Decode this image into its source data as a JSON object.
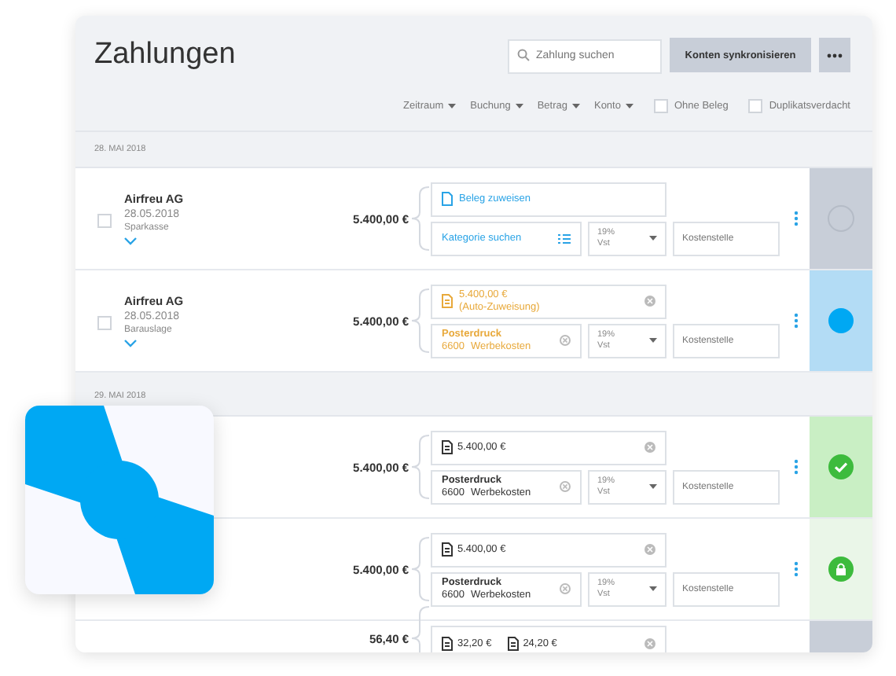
{
  "title": "Zahlungen",
  "search": {
    "placeholder": "Zahlung suchen"
  },
  "sync_button": "Konten synkronisieren",
  "filters": [
    {
      "kind": "dropdown",
      "label": "Zeitraum"
    },
    {
      "kind": "dropdown",
      "label": "Buchung"
    },
    {
      "kind": "dropdown",
      "label": "Betrag"
    },
    {
      "kind": "dropdown",
      "label": "Konto"
    },
    {
      "kind": "checkbox",
      "label": "Ohne Beleg",
      "checked": false
    },
    {
      "kind": "checkbox",
      "label": "Duplikatsverdacht",
      "checked": false
    }
  ],
  "groups": [
    {
      "date": "28. MAI 2018",
      "rows": [
        {
          "name": "Airfreu AG",
          "date": "28.05.2018",
          "account": "Sparkasse",
          "checked": false,
          "amount": "5.400,00 €",
          "receipt": {
            "kind": "assign",
            "text": "Beleg zuweisen"
          },
          "category": {
            "kind": "search",
            "text": "Kategorie suchen"
          },
          "vat": [
            "19%",
            "Vst"
          ],
          "cost_placeholder": "Kostenstelle",
          "status": {
            "kind": "empty"
          }
        },
        {
          "name": "Airfreu AG",
          "date": "28.05.2018",
          "account": "Barauslage",
          "checked": false,
          "amount": "5.400,00 €",
          "receipt": {
            "kind": "auto",
            "lines": [
              "5.400,00 €",
              "(Auto-Zuweisung)"
            ]
          },
          "category": {
            "kind": "assigned",
            "suggested": true,
            "name": "Posterdruck",
            "code": "6600",
            "account": "Werbekosten"
          },
          "vat": [
            "19%",
            "Vst"
          ],
          "cost_placeholder": "Kostenstelle",
          "status": {
            "kind": "selected"
          }
        }
      ]
    },
    {
      "date": "29. MAI 2018",
      "rows": [
        {
          "amount": "5.400,00 €",
          "receipt": {
            "kind": "amounts",
            "amounts": [
              "5.400,00 €"
            ]
          },
          "category": {
            "kind": "assigned",
            "suggested": false,
            "name": "Posterdruck",
            "code": "6600",
            "account": "Werbekosten"
          },
          "vat": [
            "19%",
            "Vst"
          ],
          "cost_placeholder": "Kostenstelle",
          "status": {
            "kind": "done"
          }
        },
        {
          "amount": "5.400,00 €",
          "receipt": {
            "kind": "amounts",
            "amounts": [
              "5.400,00 €"
            ]
          },
          "category": {
            "kind": "assigned",
            "suggested": false,
            "name": "Posterdruck",
            "code": "6600",
            "account": "Werbekosten"
          },
          "vat": [
            "19%",
            "Vst"
          ],
          "cost_placeholder": "Kostenstelle",
          "status": {
            "kind": "locked"
          }
        },
        {
          "amount": "56,40 €",
          "receipt": {
            "kind": "amounts",
            "amounts": [
              "32,20 €",
              "24,20 €"
            ]
          },
          "status": {
            "kind": "pending"
          }
        }
      ]
    }
  ]
}
